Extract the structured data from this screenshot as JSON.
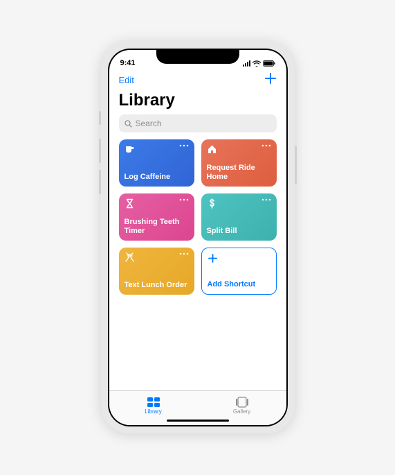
{
  "status": {
    "time": "9:41"
  },
  "nav": {
    "edit": "Edit"
  },
  "title": "Library",
  "search": {
    "placeholder": "Search"
  },
  "cards": {
    "0": {
      "title": "Log Caffeine",
      "color": "blue",
      "icon": "cup"
    },
    "1": {
      "title": "Request Ride Home",
      "color": "orange",
      "icon": "home"
    },
    "2": {
      "title": "Brushing Teeth Timer",
      "color": "pink",
      "icon": "hourglass"
    },
    "3": {
      "title": "Split Bill",
      "color": "teal",
      "icon": "dollar"
    },
    "4": {
      "title": "Text Lunch Order",
      "color": "yellow",
      "icon": "utensils"
    },
    "5": {
      "title": "Add Shortcut",
      "color": "add",
      "icon": "plus"
    }
  },
  "tabs": {
    "library": "Library",
    "gallery": "Gallery"
  }
}
